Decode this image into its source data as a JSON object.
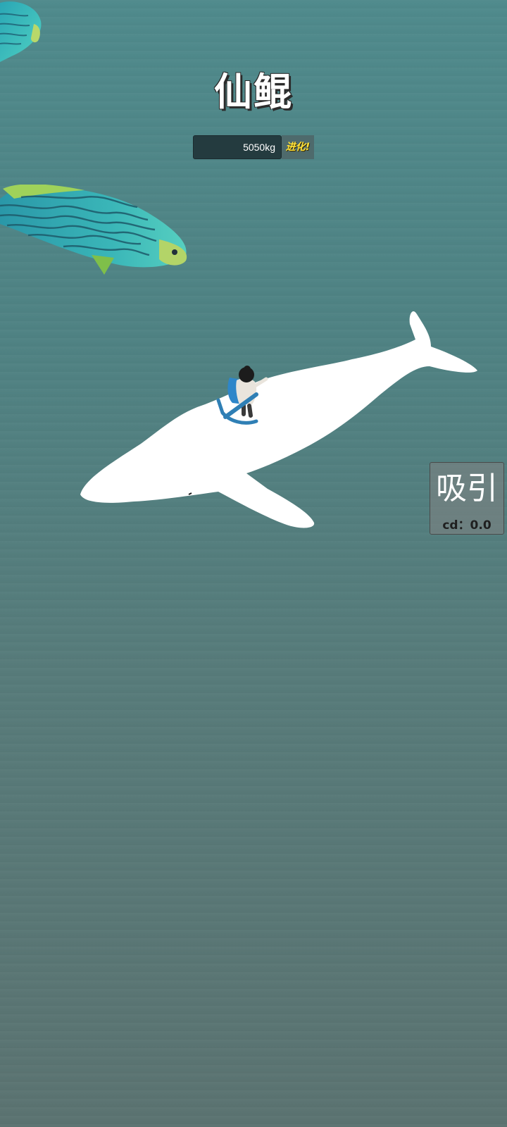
{
  "hud": {
    "title": "仙鲲",
    "weight": "5050kg",
    "weight_progress": 0.0,
    "evolve_label": "进化!"
  },
  "skill": {
    "label": "吸引",
    "cooldown": "cd：0.0"
  },
  "colors": {
    "water": "#4f8a8c",
    "whale": "#ffffff",
    "evolve": "#ffe23a"
  }
}
